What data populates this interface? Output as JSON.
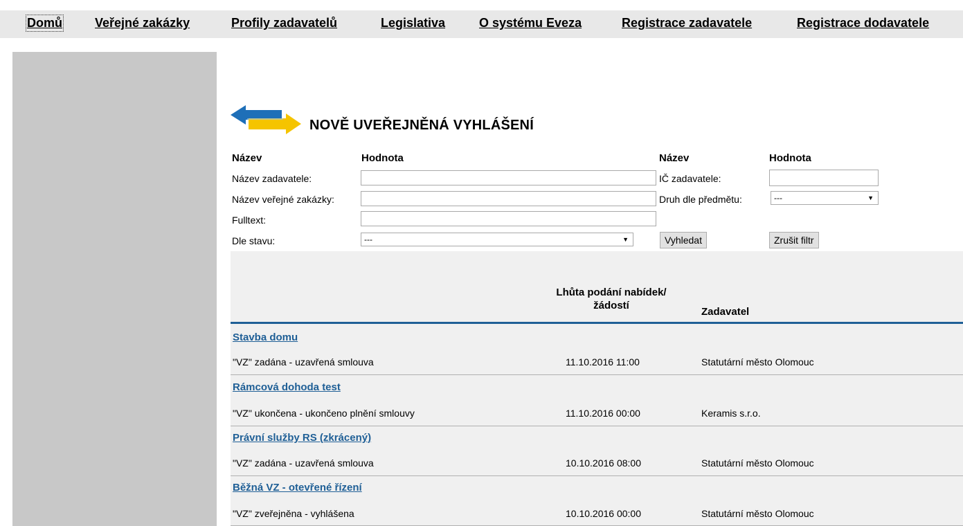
{
  "nav": {
    "items": [
      {
        "label": "Domů"
      },
      {
        "label": "Veřejné zakázky"
      },
      {
        "label": "Profily zadavatelů"
      },
      {
        "label": "Legislativa"
      },
      {
        "label": "O systému Eveza"
      },
      {
        "label": "Registrace zadavatele"
      },
      {
        "label": "Registrace dodavatele"
      }
    ],
    "active": "Domů"
  },
  "page": {
    "title": "NOVĚ UVEŘEJNĚNÁ VYHLÁŠENÍ",
    "logo_icon": "double-arrow-logo-icon",
    "colors": {
      "link": "#1f5f96",
      "sidebar": "#c8c8c8",
      "results_bg": "#f0f0f0",
      "logo_blue": "#1e6fb8",
      "logo_yellow": "#f5c400"
    }
  },
  "filter": {
    "headers": {
      "left_name": "Název",
      "left_value": "Hodnota",
      "right_name": "Název",
      "right_value": "Hodnota"
    },
    "fields": {
      "contracting_name": {
        "label": "Název zadavatele:",
        "value": ""
      },
      "contract_name": {
        "label": "Název veřejné zakázky:",
        "value": ""
      },
      "fulltext": {
        "label": "Fulltext:",
        "value": ""
      },
      "status": {
        "label": "Dle stavu:",
        "selected": "---"
      },
      "ico": {
        "label": "IČ zadavatele:",
        "value": ""
      },
      "subject_type": {
        "label": "Druh dle předmětu:",
        "selected": "---"
      }
    },
    "search_button": "Vyhledat",
    "reset_button": "Zrušit filtr"
  },
  "table": {
    "columns": {
      "deadline_line1": "Lhůta podání nabídek/",
      "deadline_line2": "žádostí",
      "contracting": "Zadavatel"
    },
    "rows": [
      {
        "title": "Stavba domu",
        "status": "\"VZ\" zadána - uzavřená smlouva",
        "deadline": "11.10.2016 11:00",
        "contracting": "Statutární město Olomouc"
      },
      {
        "title": "Rámcová dohoda test",
        "status": "\"VZ\" ukončena - ukončeno plnění smlouvy",
        "deadline": "11.10.2016 00:00",
        "contracting": "Keramis s.r.o."
      },
      {
        "title": "Právní služby RS (zkrácený)",
        "status": "\"VZ\" zadána - uzavřená smlouva",
        "deadline": "10.10.2016 08:00",
        "contracting": "Statutární město Olomouc"
      },
      {
        "title": "Běžná VZ - otevřené řízení",
        "status": "\"VZ\" zveřejněna - vyhlášena",
        "deadline": "10.10.2016 00:00",
        "contracting": "Statutární město Olomouc"
      }
    ]
  }
}
